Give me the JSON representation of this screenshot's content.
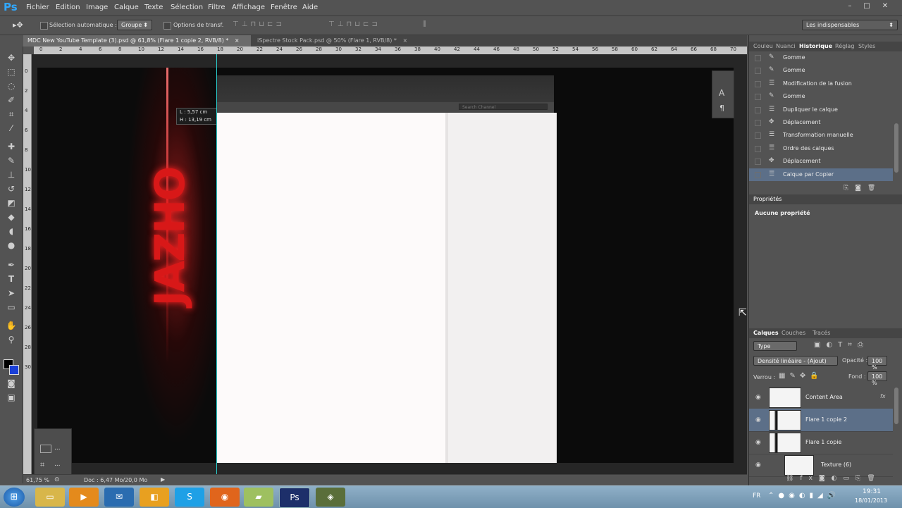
{
  "app": {
    "logo": "Ps"
  },
  "menu": [
    "Fichier",
    "Edition",
    "Image",
    "Calque",
    "Texte",
    "Sélection",
    "Filtre",
    "Affichage",
    "Fenêtre",
    "Aide"
  ],
  "window_controls": {
    "min": "–",
    "max": "□",
    "close": "✕"
  },
  "options": {
    "auto_select_label": "Sélection automatique :",
    "auto_select_value": "Groupe",
    "transform_label": "Options de transf.",
    "workspace": "Les indispensables"
  },
  "tabs": [
    {
      "title": "MDC New YouTube Template (3).psd @ 61,8% (Flare 1 copie 2, RVB/8) *",
      "close": "×"
    },
    {
      "title": "iSpectre Stock Pack.psd @ 50% (Flare 1, RVB/8) *",
      "close": "×"
    }
  ],
  "ruler_ticks": [
    "0",
    "2",
    "4",
    "6",
    "8",
    "10",
    "12",
    "14",
    "16",
    "18",
    "20",
    "22",
    "24",
    "26",
    "28",
    "30",
    "32",
    "34",
    "36",
    "38",
    "40",
    "42",
    "44",
    "46",
    "48",
    "50",
    "52",
    "54",
    "56",
    "58",
    "60",
    "62",
    "64",
    "66",
    "68",
    "70"
  ],
  "ruler_left_ticks": [
    "0",
    "2",
    "4",
    "6",
    "8",
    "10",
    "12",
    "14",
    "16",
    "18",
    "20",
    "22",
    "24",
    "26",
    "28",
    "30"
  ],
  "canvas": {
    "artwork_text": "JAZHO",
    "search_placeholder": "Search Channel",
    "measure_w": "L : 5,57 cm",
    "measure_h": "H : 13,19 cm"
  },
  "mini_panel": {
    "row1": "...",
    "row2": "..."
  },
  "status": {
    "zoom": "61,75 %",
    "doc": "Doc : 6,47 Mo/20,0 Mo"
  },
  "history_panel": {
    "tabs": [
      "Couleu",
      "Nuanci",
      "Historique",
      "Réglag",
      "Styles"
    ],
    "items": [
      {
        "label": "Gomme",
        "icon": "eraser-icon",
        "glyph": "✎"
      },
      {
        "label": "Gomme",
        "icon": "eraser-icon",
        "glyph": "✎"
      },
      {
        "label": "Modification de la fusion",
        "icon": "layer-icon",
        "glyph": "☰"
      },
      {
        "label": "Gomme",
        "icon": "eraser-icon",
        "glyph": "✎"
      },
      {
        "label": "Dupliquer le calque",
        "icon": "layer-icon",
        "glyph": "☰"
      },
      {
        "label": "Déplacement",
        "icon": "move-icon",
        "glyph": "✥"
      },
      {
        "label": "Transformation manuelle",
        "icon": "layer-icon",
        "glyph": "☰"
      },
      {
        "label": "Ordre des calques",
        "icon": "layer-icon",
        "glyph": "☰"
      },
      {
        "label": "Déplacement",
        "icon": "move-icon",
        "glyph": "✥"
      },
      {
        "label": "Calque par Copier",
        "icon": "layer-icon",
        "glyph": "☰"
      }
    ]
  },
  "properties_panel": {
    "title": "Propriétés",
    "message": "Aucune propriété"
  },
  "layers_panel": {
    "tabs": [
      "Calques",
      "Couches",
      "Tracés"
    ],
    "filter": "Type",
    "blend_mode": "Densité linéaire - (Ajout)",
    "opacity_label": "Opacité :",
    "opacity_value": "100 %",
    "lock_label": "Verrou :",
    "fill_label": "Fond :",
    "fill_value": "100 %",
    "fx": "fx",
    "layers": [
      {
        "name": "Content Area"
      },
      {
        "name": "Flare 1 copie 2"
      },
      {
        "name": "Flare 1 copie"
      },
      {
        "name": "Texture (6)"
      }
    ]
  },
  "taskbar": {
    "lang": "FR",
    "time": "19:31",
    "date": "18/01/2013"
  }
}
